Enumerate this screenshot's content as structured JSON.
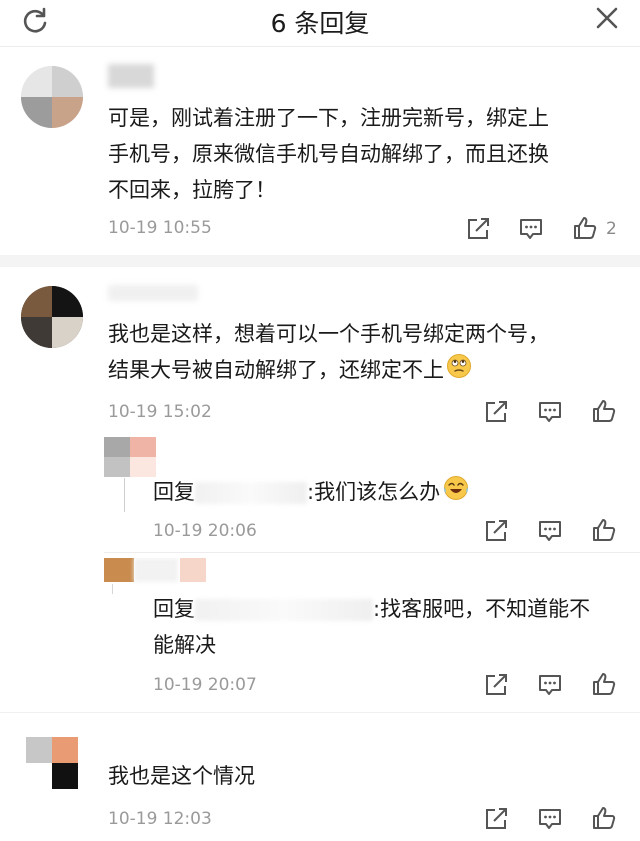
{
  "header": {
    "title": "6 条回复",
    "refresh_icon": "refresh-icon",
    "close_icon": "close-icon"
  },
  "comments": [
    {
      "text_lines": [
        "可是，刚试着注册了一下，注册完新号，绑定上",
        "手机号，原来微信手机号自动解绑了，而且还换",
        "不回来，拉胯了！"
      ],
      "time": "10-19 10:55",
      "likes": "2"
    },
    {
      "text_lines": [
        "我也是这样，想着可以一个手机号绑定两个号，",
        "结果大号被自动解绑了，还绑定不上"
      ],
      "time": "10-19 15:02",
      "replies": [
        {
          "prefix": "回复",
          "text": ":我们该怎么办",
          "time": "10-19 20:06"
        },
        {
          "prefix": "回复",
          "text_lines": [
            ":找客服吧，不知道能不",
            "能解决"
          ],
          "time": "10-19 20:07"
        }
      ]
    },
    {
      "text_lines": [
        "我也是这个情况"
      ],
      "time": "10-19 12:03"
    }
  ],
  "colors": {
    "text": "#1a1a1a",
    "time": "#9a9a9a",
    "icon": "#555555",
    "separator": "#f4f4f4"
  },
  "icons": [
    "share-icon",
    "comment-icon",
    "like-icon",
    "eye-roll-emoji",
    "crying-laugh-emoji"
  ]
}
